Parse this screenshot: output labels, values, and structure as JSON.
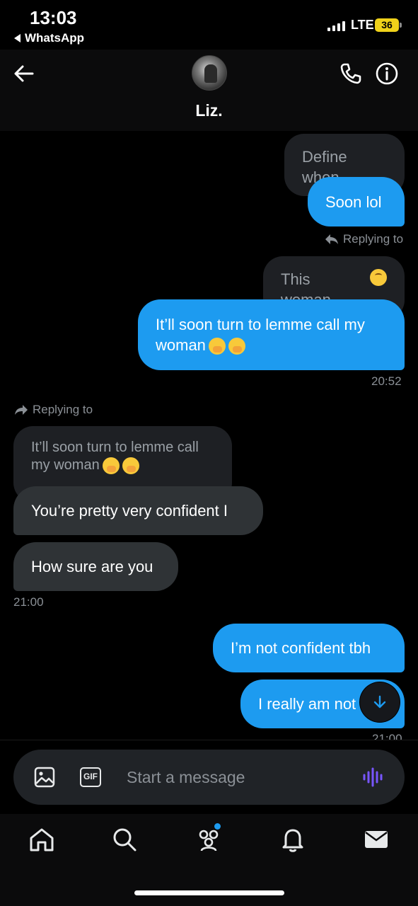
{
  "status_bar": {
    "time": "13:03",
    "back_app": "WhatsApp",
    "network": "LTE",
    "battery": "36"
  },
  "header": {
    "contact_name": "Liz.",
    "back_icon": "arrow-left-icon",
    "call_icon": "phone-icon",
    "info_icon": "info-icon"
  },
  "messages": {
    "define_when": "Define when",
    "soon_lol": "Soon lol",
    "replying_to_1": "Replying to",
    "quote_this_woman": "This woman",
    "itll_soon": "It’ll soon turn to lemme call my woman",
    "time_1": "20:52",
    "replying_to_2": "Replying to",
    "quote_itll_soon_line1": "It’ll soon turn to lemme call",
    "quote_itll_soon_line2": "my woman",
    "pretty_confident": "You’re pretty very confident I",
    "how_sure": "How sure are you",
    "time_2": "21:00",
    "not_confident": "I’m not confident tbh",
    "really_not": "I really am not",
    "time_3": "21:00"
  },
  "composer": {
    "placeholder": "Start a message",
    "gif_label": "GIF"
  },
  "nav": {
    "items": [
      "home-icon",
      "search-icon",
      "communities-icon",
      "notifications-icon",
      "messages-icon"
    ]
  },
  "colors": {
    "accent": "#1d9bf0",
    "incoming_bubble": "#2f3336",
    "background": "#000000",
    "voice_icon": "#7856ff"
  }
}
